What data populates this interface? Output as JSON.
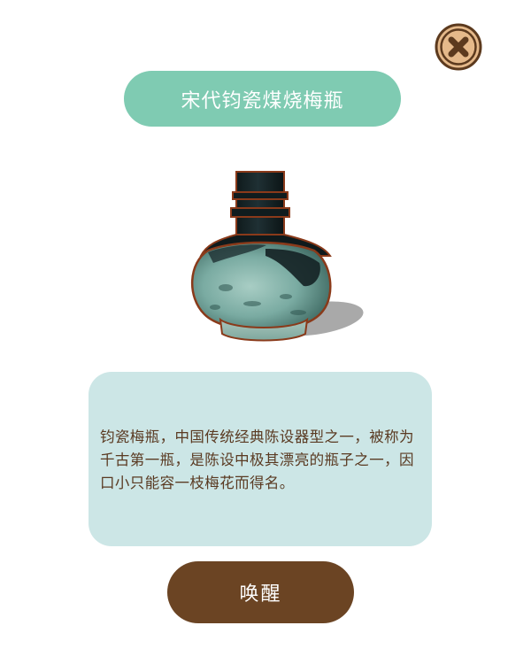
{
  "dialog": {
    "title": "宋代钧瓷煤烧梅瓶",
    "description": "钧瓷梅瓶，中国传统经典陈设器型之一，被称为千古第一瓶，是陈设中极其漂亮的瓶子之一，因口小只能容一枝梅花而得名。",
    "action_label": "唤醒",
    "close_icon": "close-icon",
    "artifact_image": "celadon-vase"
  },
  "colors": {
    "title_bg": "#7fcbb2",
    "card_bg": "#cce6e6",
    "button_bg": "#6b4423",
    "close_bg": "#e5b98a",
    "text": "#5a3a22"
  }
}
